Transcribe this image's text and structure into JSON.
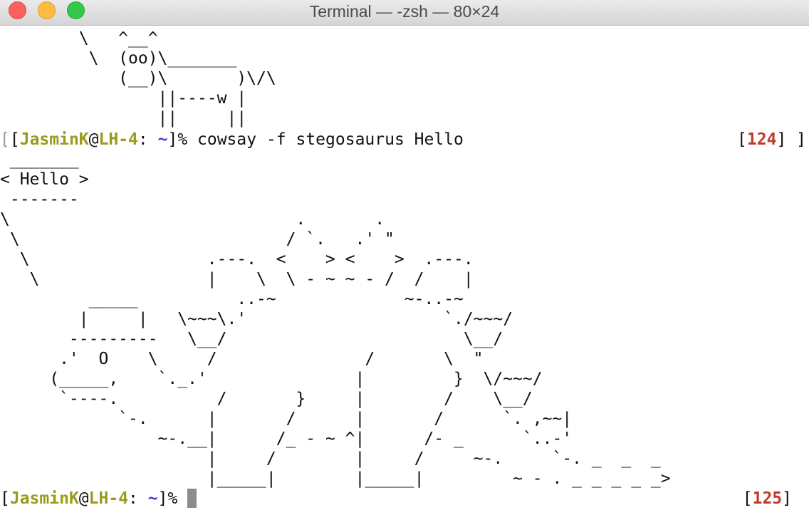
{
  "window": {
    "title": "Terminal — -zsh — 80×24"
  },
  "colors": {
    "username": "#9a9a1c",
    "path": "#3c3cd6",
    "exit_code": "#c0392b",
    "text": "#111111"
  },
  "terminal": {
    "cow_art": [
      "        \\   ^__^",
      "         \\  (oo)\\_______",
      "            (__)\\       )\\/\\",
      "                ||----w |",
      "                ||     ||"
    ],
    "prompt1": {
      "open_bracket": "[",
      "user": "JasminK",
      "at": "@",
      "host": "LH-4",
      "sep": ": ",
      "path": "~",
      "close": "]% ",
      "command": "cowsay -f stegosaurus Hello",
      "rprompt_open": "[",
      "exit_code": "124",
      "rprompt_close": "] ]"
    },
    "stego_art": [
      " _______",
      "< Hello >",
      " -------",
      "\\                             .       .",
      " \\                           / `.   .' \"",
      "  \\                  .---.  <    > <    >  .---.",
      "   \\                 |    \\  \\ - ~ ~ - /  /    |",
      "         _____          ..-~             ~-..-~",
      "        |     |   \\~~~\\.'                    `./~~~/",
      "       ---------   \\__/                        \\__/",
      "      .'  O    \\     /               /       \\  \"",
      "     (_____,    `._.'               |         }  \\/~~~/",
      "      `----.          /       }     |        /    \\__/",
      "            `-.      |       /      |       /      `. ,~~|",
      "                ~-.__|      /_ - ~ ^|      /- _      `..-'",
      "                     |     /        |     /     ~-.     `-. _  _  _",
      "                     |_____|        |_____|         ~ - . _ _ _ _ _>"
    ],
    "prompt2": {
      "open_bracket": "[",
      "user": "JasminK",
      "at": "@",
      "host": "LH-4",
      "sep": ": ",
      "path": "~",
      "close": "]% ",
      "rprompt_open": "[",
      "exit_code": "125",
      "rprompt_close": "]"
    }
  }
}
